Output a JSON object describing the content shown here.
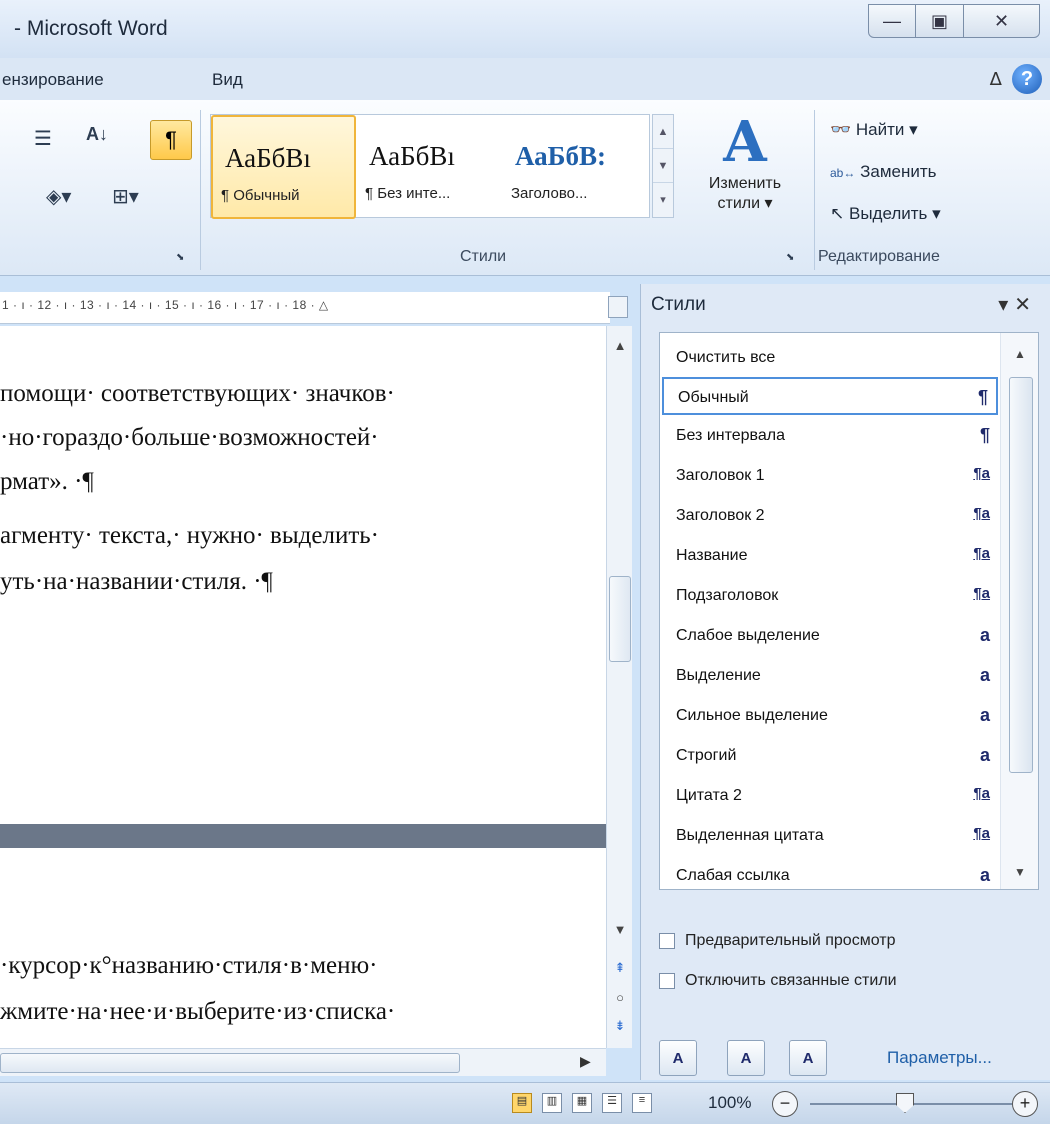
{
  "window": {
    "title": "- Microsoft Word",
    "minimize": "—",
    "maximize": "▣",
    "close": "✕"
  },
  "tabs": [
    {
      "label": "ензирование"
    },
    {
      "label": "Вид"
    }
  ],
  "help": {
    "collapse": "ᐃ",
    "help": "?"
  },
  "ribbon": {
    "pilcrow": "¶",
    "sort": "A↓",
    "styles_gallery": [
      {
        "sample": "АаБбВı",
        "name": "¶ Обычный",
        "selected": true
      },
      {
        "sample": "АаБбВı",
        "name": "¶ Без инте..."
      },
      {
        "sample": "АаБбВ:",
        "name": "Заголово..."
      }
    ],
    "change_styles_label": "Изменить",
    "change_styles_label2": "стили ▾",
    "styles_group_label": "Стили",
    "editing": {
      "find": "Найти ▾",
      "replace": "Заменить",
      "select": "Выделить ▾",
      "group_label": "Редактирование"
    }
  },
  "ruler": {
    "text": "1 · ı · 12 · ı · 13 · ı · 14 · ı · 15 · ı · 16 · ı · 17 · ı · 18 · △"
  },
  "document": {
    "lines": [
      "помощи· соответствующих· значков·",
      "·но·гораздо·больше·возможностей·",
      "рмат». ·¶",
      "агменту· текста,· нужно· выделить·",
      "уть·на·названии·стиля. ·¶",
      "·курсор·к°названию·стиля·в·меню·",
      "жмите·на·нее·и·выберите·из·списка·"
    ]
  },
  "styles_pane": {
    "title": "Стили",
    "items": [
      {
        "name": "Очистить все",
        "mark": ""
      },
      {
        "name": "Обычный",
        "mark": "¶",
        "selected": true
      },
      {
        "name": "Без интервала",
        "mark": "¶"
      },
      {
        "name": "Заголовок 1",
        "mark": "¶a"
      },
      {
        "name": "Заголовок 2",
        "mark": "¶a"
      },
      {
        "name": "Название",
        "mark": "¶a"
      },
      {
        "name": "Подзаголовок",
        "mark": "¶a"
      },
      {
        "name": "Слабое выделение",
        "mark": "a"
      },
      {
        "name": "Выделение",
        "mark": "a"
      },
      {
        "name": "Сильное выделение",
        "mark": "a"
      },
      {
        "name": "Строгий",
        "mark": "a"
      },
      {
        "name": "Цитата 2",
        "mark": "¶a"
      },
      {
        "name": "Выделенная цитата",
        "mark": "¶a"
      },
      {
        "name": "Слабая ссылка",
        "mark": "a"
      }
    ],
    "preview_label": "Предварительный просмотр",
    "disable_linked_label": "Отключить связанные стили",
    "params_link": "Параметры..."
  },
  "status": {
    "zoom": "100%"
  }
}
